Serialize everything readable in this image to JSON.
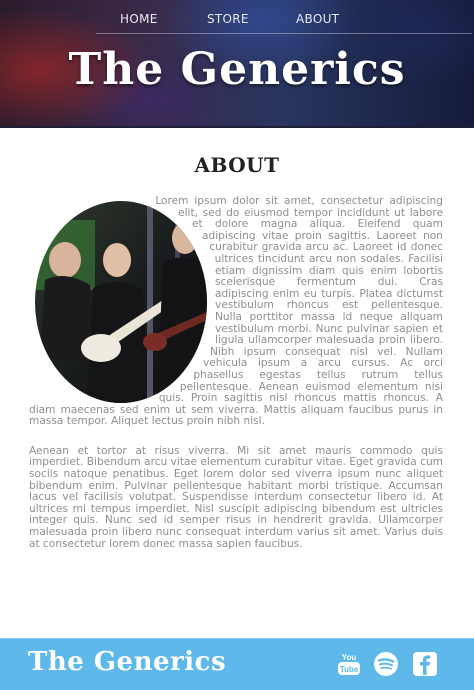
{
  "nav": {
    "items": [
      {
        "label": "HOME"
      },
      {
        "label": "STORE"
      },
      {
        "label": "ABOUT"
      }
    ]
  },
  "header": {
    "title": "The Generics"
  },
  "main": {
    "section_title": "ABOUT",
    "paragraph1": "Lorem ipsum dolor sit amet, consectetur adipiscing elit, sed do eiusmod tempor incididunt ut labore et dolore magna aliqua. Eleifend quam adipiscing vitae proin sagittis. Laoreet non curabitur gravida arcu ac. Laoreet id donec ultrices tincidunt arcu non sodales. Facilisi etiam dignissim diam quis enim lobortis scelerisque fermentum dui. Cras adipiscing enim eu turpis. Platea dictumst vestibulum rhoncus est pellentesque. Nulla porttitor massa id neque aliquam vestibulum morbi. Nunc pulvinar sapien et ligula ullamcorper malesuada proin libero. Nibh ipsum consequat nisl vel. Nullam vehicula ipsum a arcu cursus. Ac orci phasellus egestas tellus rutrum tellus pellentesque. Aenean euismod elementum nisi quis. Proin sagittis nisl rhoncus mattis rhoncus. A diam maecenas sed enim ut sem viverra. Mattis aliquam faucibus purus in massa tempor. Aliquet lectus proin nibh nisl.",
    "paragraph2": "Aenean et tortor at risus viverra. Mi sit amet mauris commodo quis imperdiet. Bibendum arcu vitae elementum curabitur vitae. Eget gravida cum sociis natoque penatibus. Eget lorem dolor sed viverra ipsum nunc aliquet bibendum enim. Pulvinar pellentesque habitant morbi tristique. Accumsan lacus vel facilisis volutpat. Suspendisse interdum consectetur libero id. At ultrices mi tempus imperdiet. Nisl suscipit adipiscing bibendum est ultricies integer quis. Nunc sed id semper risus in hendrerit gravida. Ullamcorper malesuada proin libero nunc consequat interdum varius sit amet. Varius duis at consectetur lorem donec massa sapien faucibus.",
    "photo_icon": "band-photo"
  },
  "footer": {
    "title": "The Generics",
    "social": [
      {
        "icon": "youtube-icon",
        "label": "You Tube"
      },
      {
        "icon": "spotify-icon"
      },
      {
        "icon": "facebook-icon",
        "label": "f"
      }
    ]
  },
  "colors": {
    "footer_bg": "#5eb8ea",
    "body_text": "#8e8e8e",
    "heading": "#222222"
  }
}
